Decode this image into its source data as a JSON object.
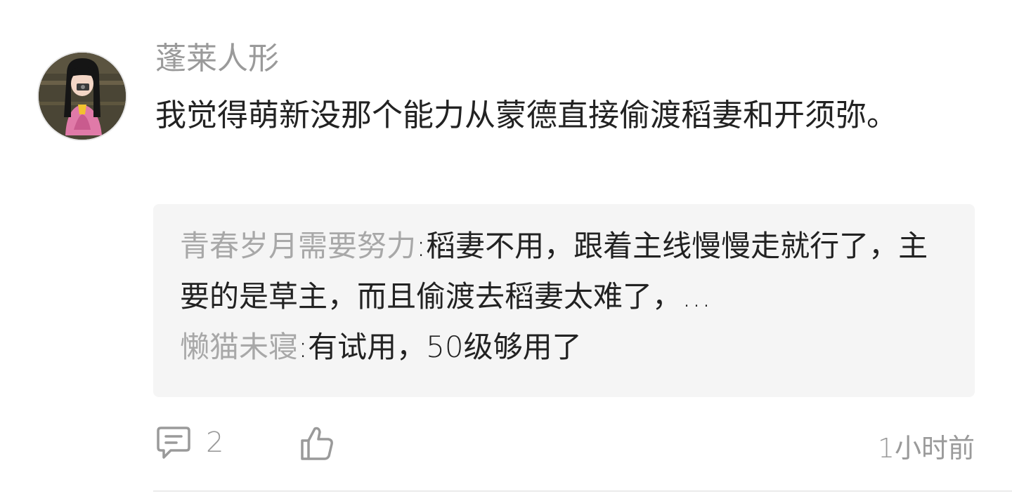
{
  "comment": {
    "author": "蓬莱人形",
    "text": "我觉得萌新没那个能力从蒙德直接偷渡稻妻和开须弥。",
    "replies": [
      {
        "author": "青春岁月需要努力",
        "separator": ":",
        "text": "稻妻不用，跟着主线慢慢走就行了，主要的是草主，而且偷渡去稻妻太难了，…"
      },
      {
        "author": "懒猫未寝",
        "separator": ":",
        "text": "有试用，50级够用了"
      }
    ],
    "reply_count": "2",
    "timestamp": "1小时前"
  },
  "icons": {
    "comment": "comment-bubble-icon",
    "like": "thumbs-up-icon"
  },
  "colors": {
    "muted_text": "#9a9a9a",
    "body_text": "#222222",
    "reply_bg": "#f5f5f5"
  }
}
